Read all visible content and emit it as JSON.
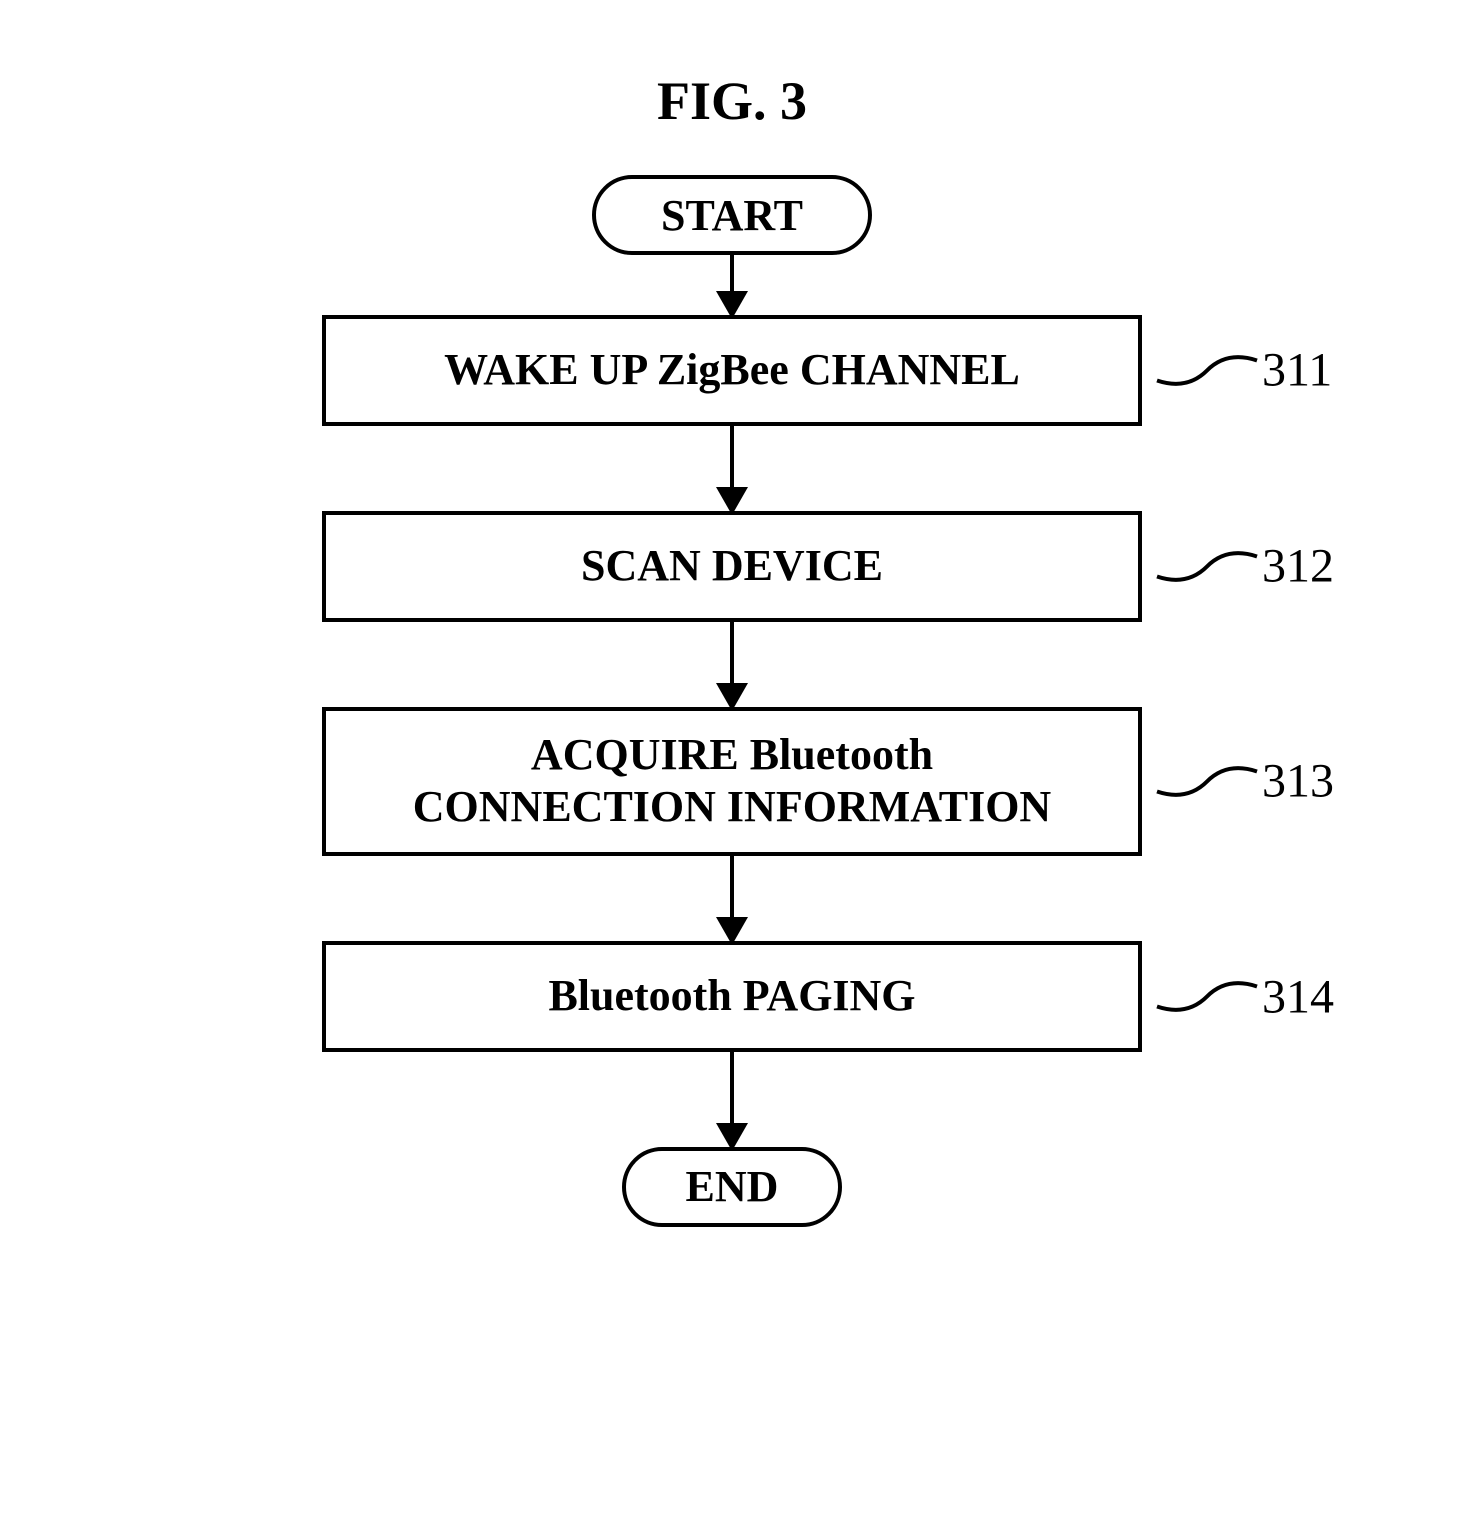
{
  "figure": {
    "title": "FIG. 3"
  },
  "terminator": {
    "start": "START",
    "end": "END"
  },
  "steps": [
    {
      "id": "311",
      "text": "WAKE UP ZigBee CHANNEL"
    },
    {
      "id": "312",
      "text": "SCAN DEVICE"
    },
    {
      "id": "313",
      "text": "ACQUIRE Bluetooth\nCONNECTION INFORMATION"
    },
    {
      "id": "314",
      "text": "Bluetooth PAGING"
    }
  ],
  "chart_data": {
    "type": "flowchart",
    "title": "FIG. 3",
    "nodes": [
      {
        "id": "start",
        "type": "terminator",
        "label": "START"
      },
      {
        "id": "311",
        "type": "process",
        "label": "WAKE UP ZigBee CHANNEL"
      },
      {
        "id": "312",
        "type": "process",
        "label": "SCAN DEVICE"
      },
      {
        "id": "313",
        "type": "process",
        "label": "ACQUIRE Bluetooth CONNECTION INFORMATION"
      },
      {
        "id": "314",
        "type": "process",
        "label": "Bluetooth PAGING"
      },
      {
        "id": "end",
        "type": "terminator",
        "label": "END"
      }
    ],
    "edges": [
      {
        "from": "start",
        "to": "311"
      },
      {
        "from": "311",
        "to": "312"
      },
      {
        "from": "312",
        "to": "313"
      },
      {
        "from": "313",
        "to": "314"
      },
      {
        "from": "314",
        "to": "end"
      }
    ]
  }
}
